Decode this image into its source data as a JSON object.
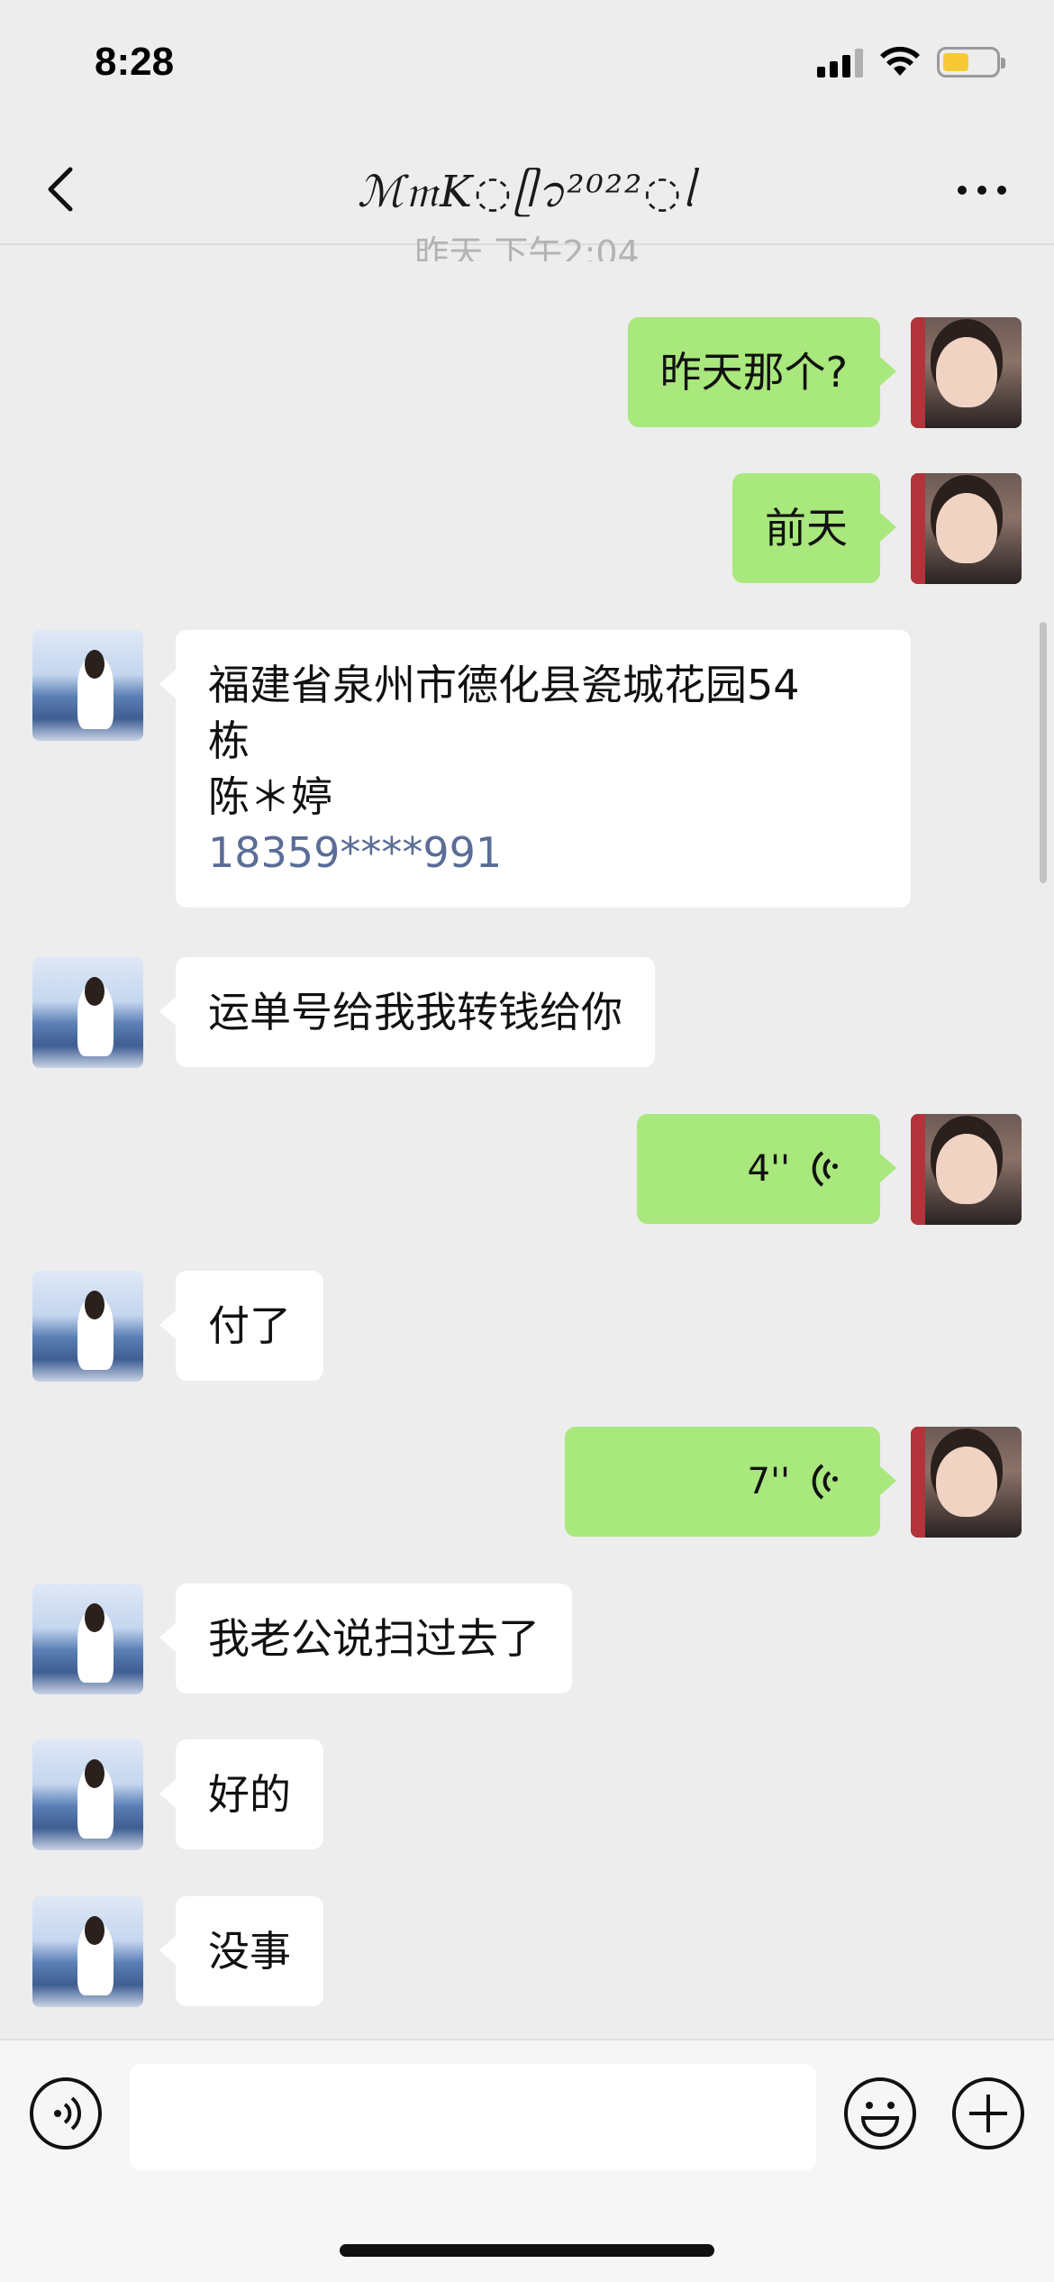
{
  "status_bar": {
    "time": "8:28"
  },
  "header": {
    "title": "ℳ𝔪K◌ᥫ᭡²⁰²²◌ᥣ",
    "timestamp": "昨天 下午2:04"
  },
  "messages": [
    {
      "from": "me",
      "text": "昨天那个?"
    },
    {
      "from": "me",
      "text": "前天"
    },
    {
      "from": "them",
      "line1": "福建省泉州市德化县瓷城花园54",
      "line2": "栋",
      "line3": "陈＊婷",
      "phone": "18359****991"
    },
    {
      "from": "them",
      "text": "运单号给我我转钱给你"
    },
    {
      "from": "me",
      "voice": "4''"
    },
    {
      "from": "them",
      "text": "付了"
    },
    {
      "from": "me",
      "voice": "7''"
    },
    {
      "from": "them",
      "text": "我老公说扫过去了"
    },
    {
      "from": "them",
      "text": "好的"
    },
    {
      "from": "them",
      "text": "没事"
    }
  ],
  "input": {
    "value": ""
  },
  "icons": {
    "back": "chevron-left-icon",
    "more": "more-dots-icon",
    "voice": "voice-icon",
    "emoji": "emoji-icon",
    "plus": "plus-icon",
    "wave": "voice-wave-icon"
  },
  "colors": {
    "my_bubble": "#a9e87c",
    "their_bubble": "#ffffff",
    "background": "#ededed",
    "phone_link": "#5a6d97"
  }
}
